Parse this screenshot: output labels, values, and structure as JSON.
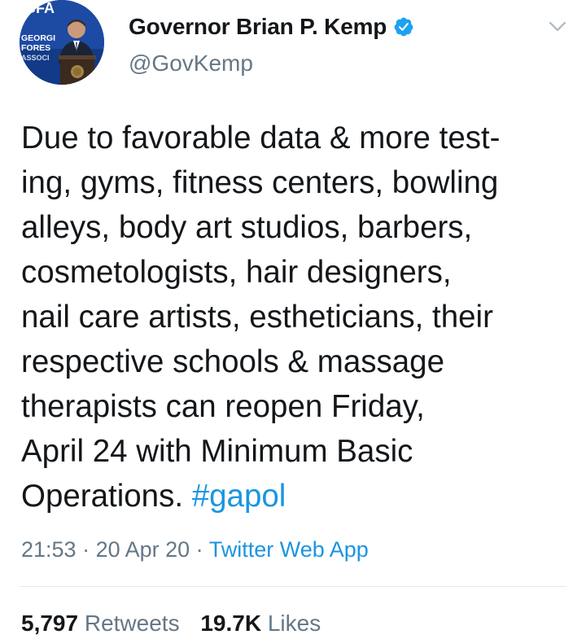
{
  "author": {
    "display_name": "Governor Brian P. Kemp",
    "handle": "@GovKemp",
    "verified": true,
    "avatar_icon": "profile-photo",
    "avatar_text_line1": "GFA",
    "avatar_text_line2": "GEORGI",
    "avatar_text_line3": "FORES",
    "avatar_text_line4": "ASSOCI"
  },
  "tweet": {
    "lines": [
      "Due to favorable data & more test-",
      "ing, gyms, fitness centers, bowling",
      "alleys, body art studios, barbers,",
      "cosmetologists, hair designers,",
      "nail care artists, estheticians, their",
      "respective schools & massage",
      "therapists can reopen Friday,",
      "April 24 with Minimum Basic",
      "Operations."
    ],
    "hashtag": "#gapol"
  },
  "meta": {
    "time": "21:53",
    "sep1": " · ",
    "date": "20 Apr 20",
    "sep2": " · ",
    "source": "Twitter Web App"
  },
  "stats": {
    "retweets_count": "5,797",
    "retweets_label": "Retweets",
    "likes_count": "19.7K",
    "likes_label": "Likes"
  },
  "colors": {
    "link": "#1b95e0",
    "secondary_text": "#657786",
    "primary_text": "#14171a",
    "divider": "#e1e8ed"
  },
  "icons": {
    "verified": "verified-badge-icon",
    "caret": "chevron-down-icon"
  }
}
